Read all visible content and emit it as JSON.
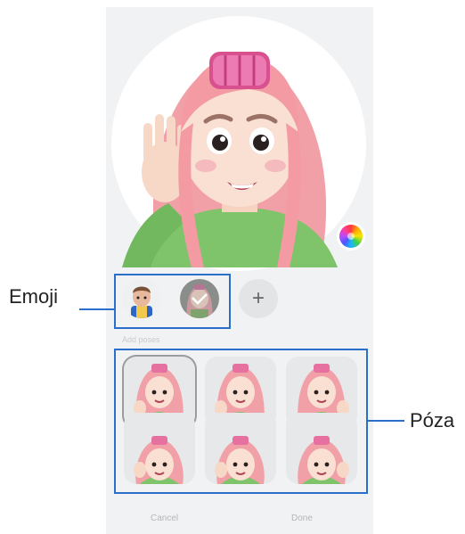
{
  "screen": {
    "add_label": "Add poses",
    "add_button_symbol": "+",
    "cancel_label": "Cancel",
    "done_label": "Done"
  },
  "callouts": {
    "emoji": "Emoji",
    "pose": "Póza"
  },
  "colors": {
    "callout": "#2a6fc9",
    "hair": "#f2a0a8",
    "sweater": "#7fc36a"
  },
  "icons": [
    "color-palette-icon",
    "add-icon",
    "check-icon"
  ]
}
